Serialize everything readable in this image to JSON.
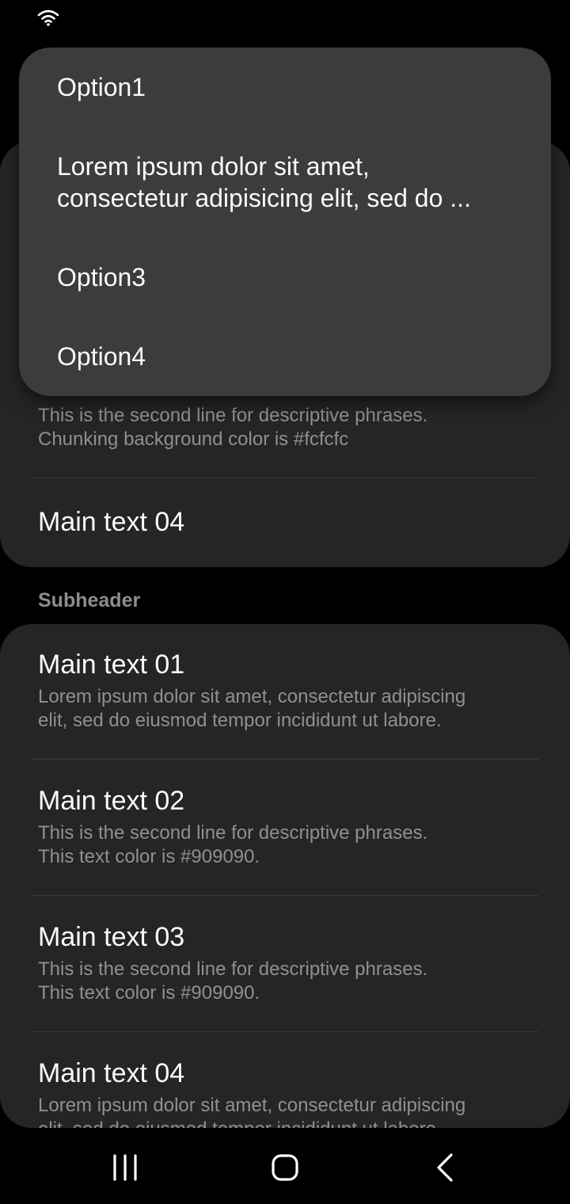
{
  "popup": {
    "options": [
      {
        "label": "Option1"
      },
      {
        "label": "Lorem ipsum dolor sit amet,\nconsectetur adipisicing elit, sed do ..."
      },
      {
        "label": "Option3"
      },
      {
        "label": "Option4"
      }
    ]
  },
  "top_card": {
    "item3_sub": "This is the second line for descriptive phrases.\nChunking background color is #fcfcfc",
    "item4_main": "Main text 04"
  },
  "subheader": "Subheader",
  "bottom_card": {
    "items": [
      {
        "main": "Main text 01",
        "sub": "Lorem ipsum dolor sit amet, consectetur adipiscing\nelit, sed do eiusmod tempor incididunt ut labore."
      },
      {
        "main": "Main text 02",
        "sub": "This is the second line for descriptive phrases.\nThis text color is #909090."
      },
      {
        "main": "Main text 03",
        "sub": "This is the second line for descriptive phrases.\nThis text color is #909090."
      },
      {
        "main": "Main text 04",
        "sub": "Lorem ipsum dolor sit amet, consectetur adipiscing\nelit, sed do eiusmod tempor incididunt ut labore."
      }
    ]
  },
  "icons": {
    "status": "wifi-icon",
    "nav": [
      "recents-icon",
      "home-icon",
      "back-icon"
    ]
  },
  "colors": {
    "background": "#000000",
    "card": "#252525",
    "popup": "#3c3c3c",
    "primary_text": "#fafafa",
    "secondary_text": "#909090"
  }
}
